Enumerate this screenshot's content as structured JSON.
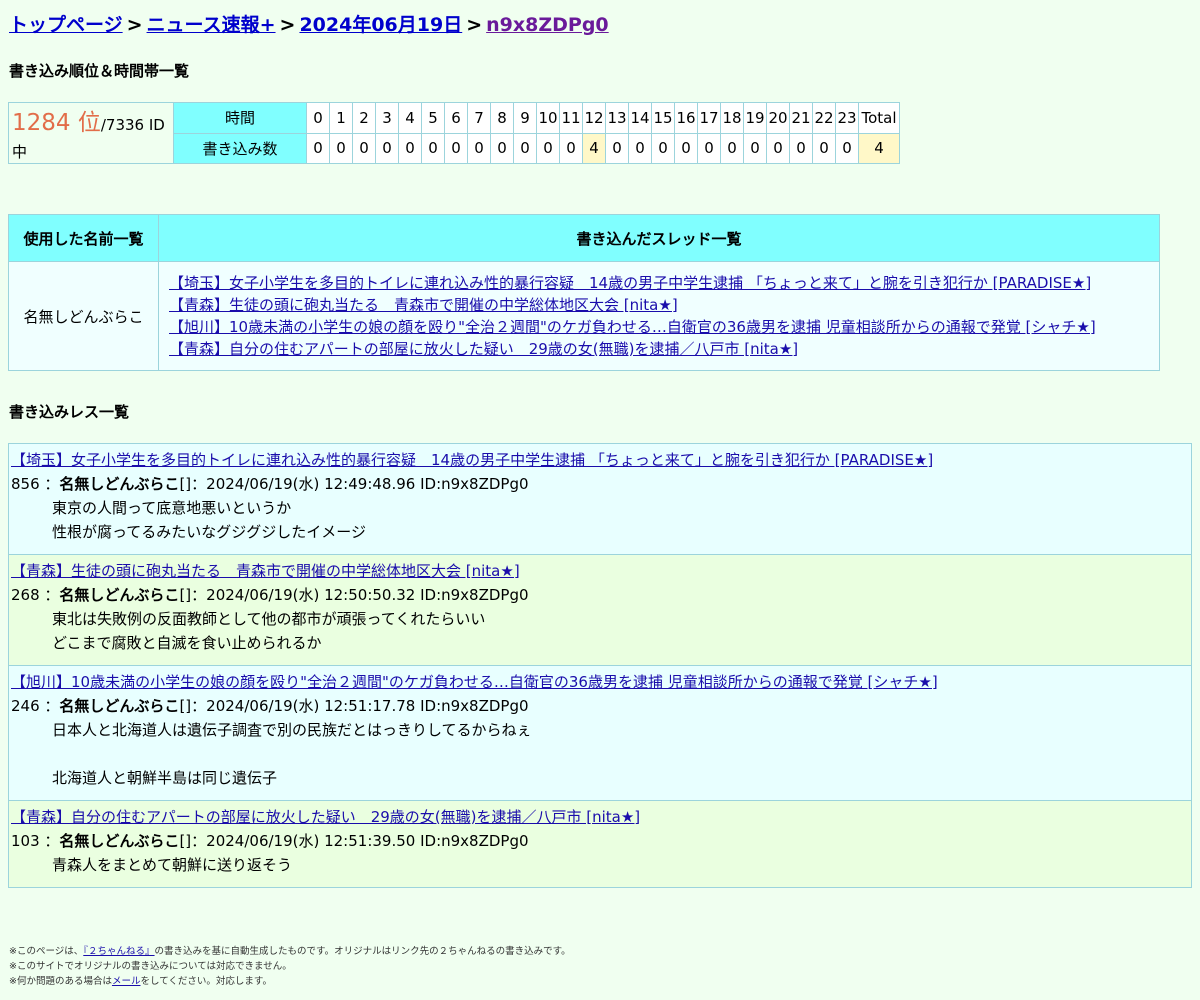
{
  "breadcrumb": {
    "items": [
      "トップページ",
      "ニュース速報+",
      "2024年06月19日",
      "n9x8ZDPg0"
    ],
    "sep": ">"
  },
  "headings": {
    "ranking": "書き込み順位＆時間帯一覧",
    "posts": "書き込みレス一覧"
  },
  "rank": {
    "position": "1284 位",
    "total": "/7336 ID中",
    "time_label": "時間",
    "count_label": "書き込み数",
    "hours": [
      "0",
      "1",
      "2",
      "3",
      "4",
      "5",
      "6",
      "7",
      "8",
      "9",
      "10",
      "11",
      "12",
      "13",
      "14",
      "15",
      "16",
      "17",
      "18",
      "19",
      "20",
      "21",
      "22",
      "23"
    ],
    "counts": [
      "0",
      "0",
      "0",
      "0",
      "0",
      "0",
      "0",
      "0",
      "0",
      "0",
      "0",
      "0",
      "4",
      "0",
      "0",
      "0",
      "0",
      "0",
      "0",
      "0",
      "0",
      "0",
      "0",
      "0"
    ],
    "total_label": "Total",
    "total_value": "4",
    "highlight_color": "#fff8c8"
  },
  "names_table": {
    "col1": "使用した名前一覧",
    "col2": "書き込んだスレッド一覧",
    "name": "名無しどんぶらこ",
    "threads": [
      "【埼玉】女子小学生を多目的トイレに連れ込み性的暴行容疑　14歳の男子中学生逮捕 「ちょっと来て」と腕を引き犯行か [PARADISE★]",
      "【青森】生徒の頭に砲丸当たる　青森市で開催の中学総体地区大会 [nita★]",
      "【旭川】10歳未満の小学生の娘の顔を殴り\"全治２週間\"のケガ負わせる…自衛官の36歳男を逮捕 児童相談所からの通報で発覚 [シャチ★]",
      "【青森】自分の住むアパートの部屋に放火した疑い　29歳の女(無職)を逮捕／八戸市 [nita★]"
    ]
  },
  "posts": [
    {
      "thread": "【埼玉】女子小学生を多目的トイレに連れ込み性的暴行容疑　14歳の男子中学生逮捕 「ちょっと来て」と腕を引き犯行か [PARADISE★]",
      "num": "856",
      "name": "名無しどんぶらこ",
      "mail": "[]",
      "meta": "2024/06/19(水) 12:49:48.96 ID:n9x8ZDPg0",
      "body": "東京の人間って底意地悪いというか\n性根が腐ってるみたいなグジグジしたイメージ"
    },
    {
      "thread": "【青森】生徒の頭に砲丸当たる　青森市で開催の中学総体地区大会 [nita★]",
      "num": "268",
      "name": "名無しどんぶらこ",
      "mail": "[]",
      "meta": "2024/06/19(水) 12:50:50.32 ID:n9x8ZDPg0",
      "body": "東北は失敗例の反面教師として他の都市が頑張ってくれたらいい\nどこまで腐敗と自滅を食い止められるか"
    },
    {
      "thread": "【旭川】10歳未満の小学生の娘の顔を殴り\"全治２週間\"のケガ負わせる…自衛官の36歳男を逮捕 児童相談所からの通報で発覚 [シャチ★]",
      "num": "246",
      "name": "名無しどんぶらこ",
      "mail": "[]",
      "meta": "2024/06/19(水) 12:51:17.78 ID:n9x8ZDPg0",
      "body": "日本人と北海道人は遺伝子調査で別の民族だとはっきりしてるからねぇ\n\n北海道人と朝鮮半島は同じ遺伝子"
    },
    {
      "thread": "【青森】自分の住むアパートの部屋に放火した疑い　29歳の女(無職)を逮捕／八戸市 [nita★]",
      "num": "103",
      "name": "名無しどんぶらこ",
      "mail": "[]",
      "meta": "2024/06/19(水) 12:51:39.50 ID:n9x8ZDPg0",
      "body": "青森人をまとめて朝鮮に送り返そう"
    }
  ],
  "footer": {
    "line1_pre": "※このページは、",
    "line1_link": "『２ちゃんねる』",
    "line1_post": "の書き込みを基に自動生成したものです。オリジナルはリンク先の２ちゃんねるの書き込みです。",
    "line2": "※このサイトでオリジナルの書き込みについては対応できません。",
    "line3_pre": "※何か問題のある場合は",
    "line3_link": "メール",
    "line3_post": "をしてください。対応します。"
  }
}
